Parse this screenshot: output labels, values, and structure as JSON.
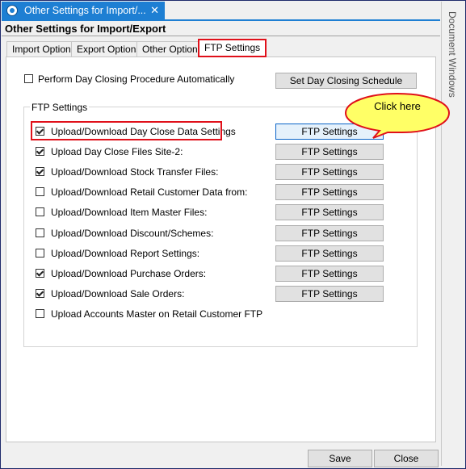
{
  "window": {
    "doc_tab_title": "Other Settings for Import/...",
    "close_glyph": "✕",
    "title": "Other Settings for Import/Export",
    "side_panel_label": "Document Windows"
  },
  "tabs": [
    {
      "label": "Import Options",
      "active": false
    },
    {
      "label": "Export Options",
      "active": false
    },
    {
      "label": "Other Options",
      "active": false
    },
    {
      "label": "FTP Settings",
      "active": true
    }
  ],
  "day_closing": {
    "auto_label": "Perform Day Closing Procedure Automatically",
    "auto_checked": false,
    "schedule_button": "Set Day Closing Schedule"
  },
  "ftp_group": {
    "legend": "FTP Settings",
    "rows": [
      {
        "label": "Upload/Download Day Close Data  Settings",
        "checked": true,
        "button": "FTP Settings"
      },
      {
        "label": "Upload Day Close Files Site-2:",
        "checked": true,
        "button": "FTP Settings"
      },
      {
        "label": "Upload/Download  Stock Transfer Files:",
        "checked": true,
        "button": "FTP Settings"
      },
      {
        "label": "Upload/Download Retail Customer Data from:",
        "checked": false,
        "button": "FTP Settings"
      },
      {
        "label": "Upload/Download  Item Master Files:",
        "checked": false,
        "button": "FTP Settings"
      },
      {
        "label": "Upload/Download  Discount/Schemes:",
        "checked": false,
        "button": "FTP Settings"
      },
      {
        "label": "Upload/Download  Report Settings:",
        "checked": false,
        "button": "FTP Settings"
      },
      {
        "label": "Upload/Download Purchase Orders:",
        "checked": true,
        "button": "FTP Settings"
      },
      {
        "label": "Upload/Download Sale Orders:",
        "checked": true,
        "button": "FTP Settings"
      },
      {
        "label": "Upload Accounts Master on Retail Customer FTP",
        "checked": false
      }
    ]
  },
  "annotation": {
    "callout_text": "Click here",
    "callout_fill": "#ffff66",
    "highlight_color": "#e0101a"
  },
  "footer": {
    "save": "Save",
    "close": "Close"
  }
}
